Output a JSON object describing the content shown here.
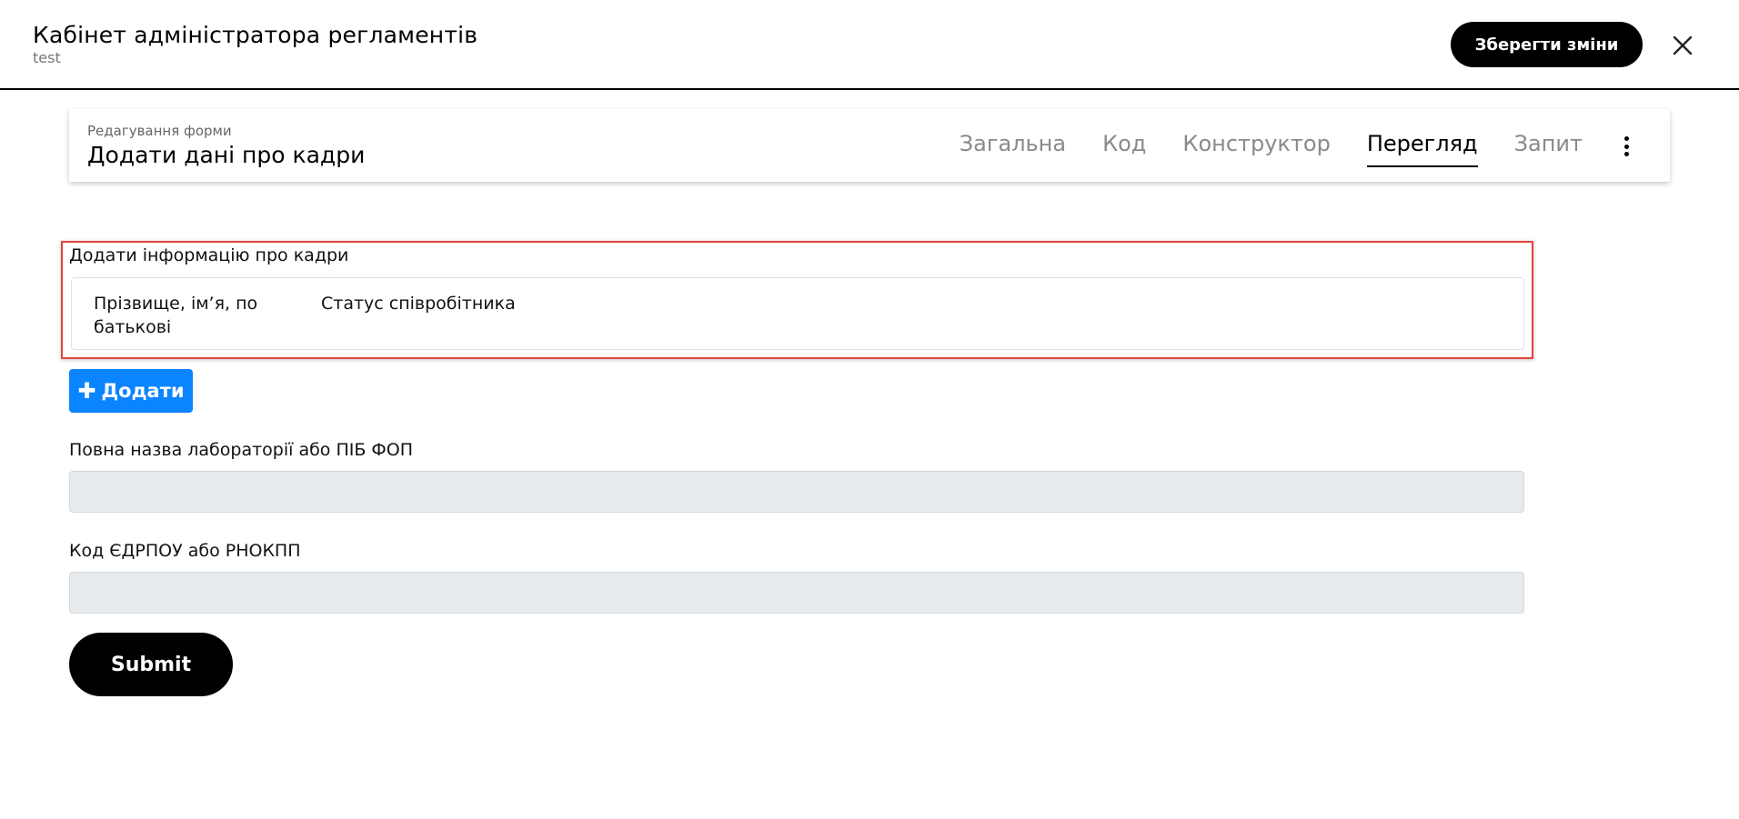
{
  "header": {
    "title": "Кабінет адміністратора регламентів",
    "subtitle": "test",
    "save_label": "Зберегти зміни",
    "close_icon": "close-icon"
  },
  "form_card": {
    "caption": "Редагування форми",
    "title": "Додати дані про кадри",
    "tabs": [
      {
        "label": "Загальна",
        "active": false
      },
      {
        "label": "Код",
        "active": false
      },
      {
        "label": "Конструктор",
        "active": false
      },
      {
        "label": "Перегляд",
        "active": true
      },
      {
        "label": "Запит",
        "active": false
      }
    ],
    "more_icon": "more-vertical-icon"
  },
  "data_grid": {
    "label": "Додати інформацію про кадри",
    "columns": [
      "Прізвище, ім’я, по батькові",
      "Статус співробітника"
    ],
    "add_label": "Додати",
    "highlight_color": "#e2443e"
  },
  "fields": [
    {
      "label": "Повна назва лабораторії або ПІБ ФОП",
      "value": ""
    },
    {
      "label": "Код ЄДРПОУ або РНОКПП",
      "value": ""
    }
  ],
  "submit_label": "Submit",
  "colors": {
    "primary_button": "#000000",
    "add_button": "#0a84ff",
    "input_background": "#e8ebee"
  }
}
